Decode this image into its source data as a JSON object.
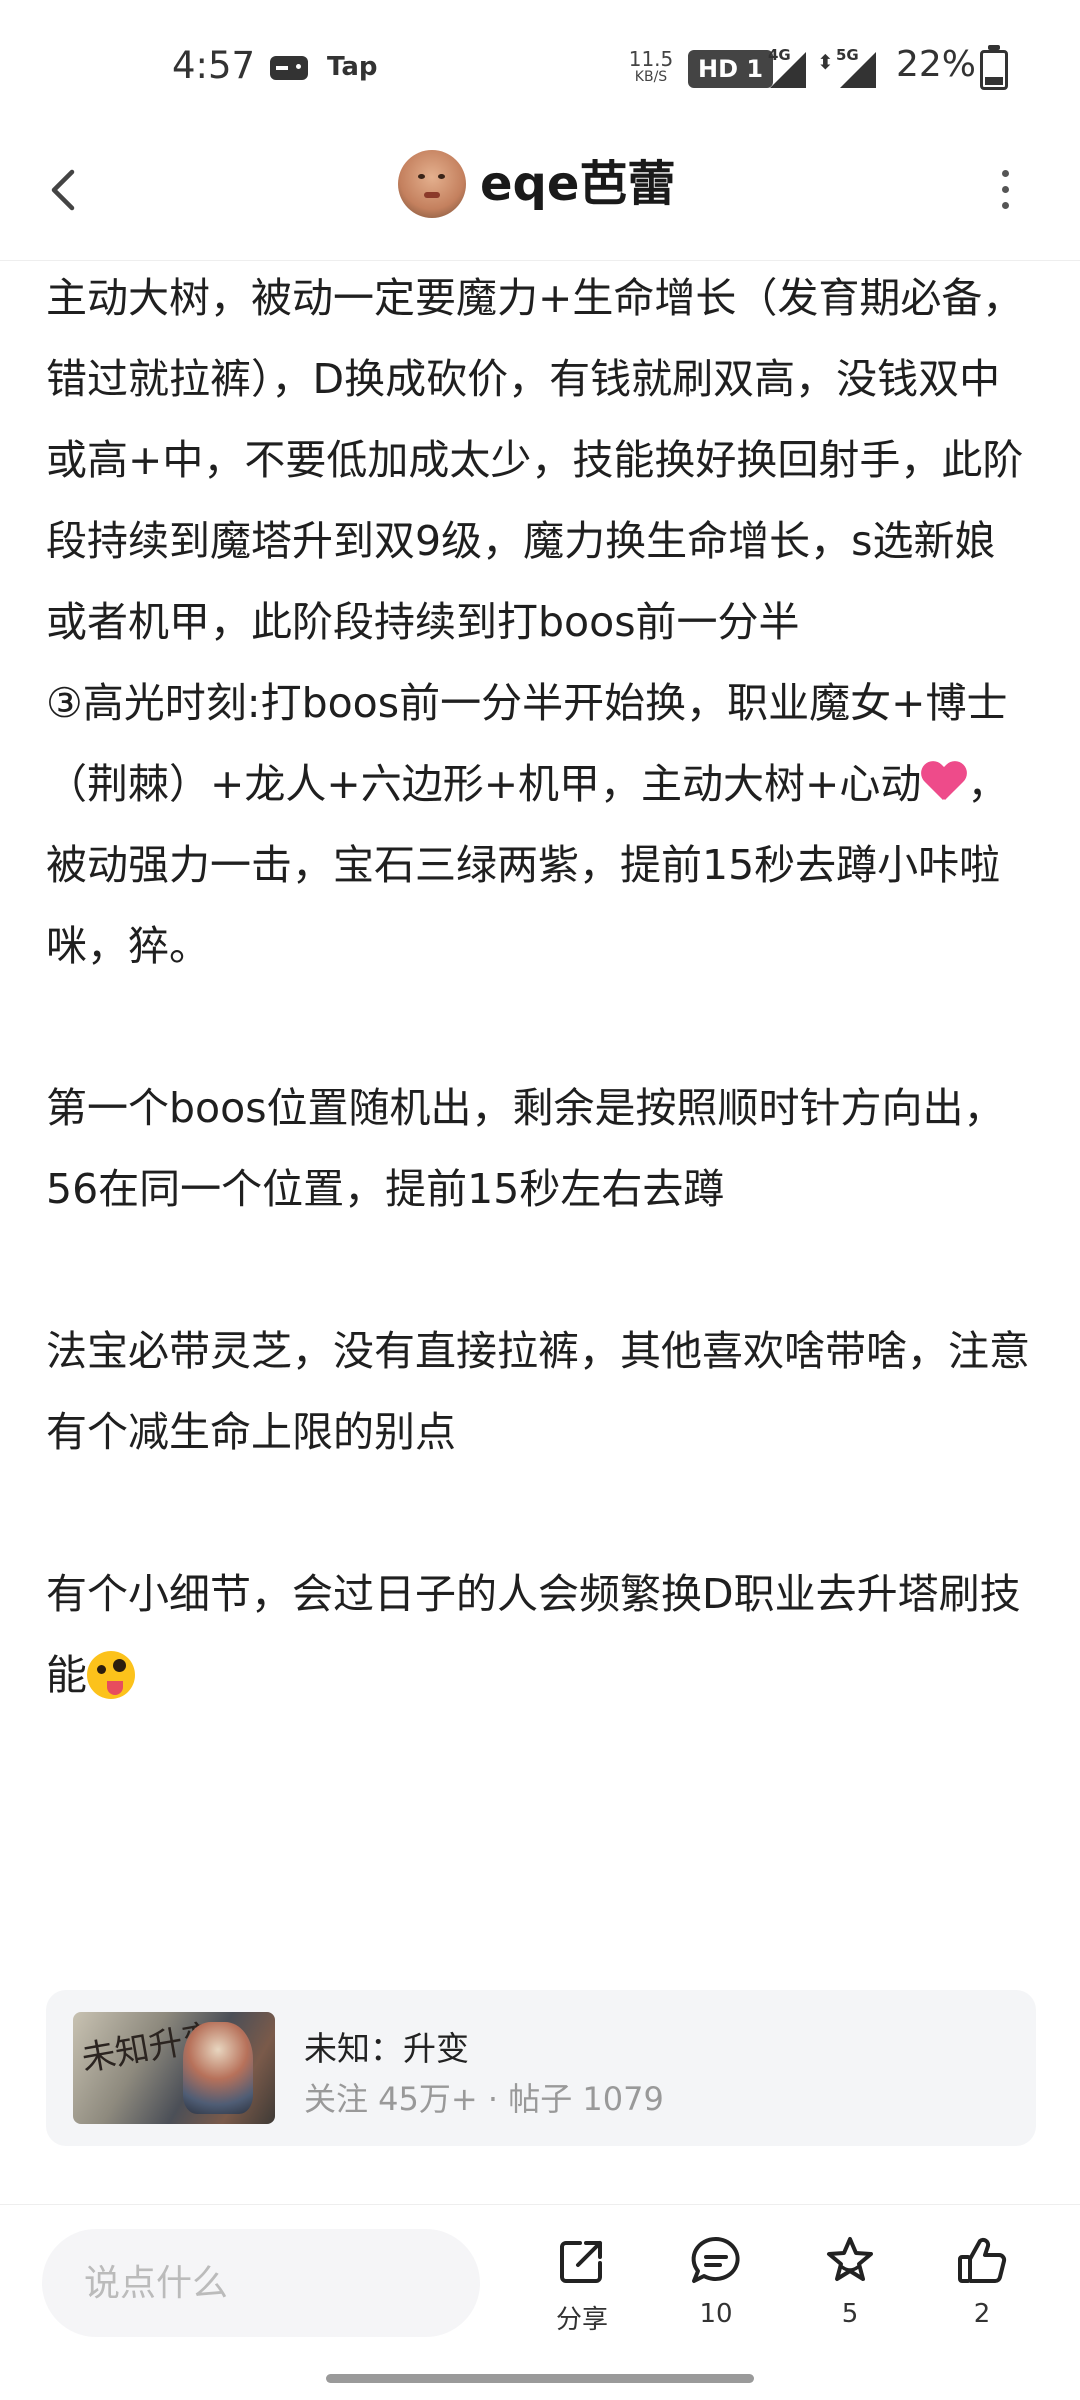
{
  "status_bar": {
    "time": "4:57",
    "tap_label": "Tap",
    "speed_value": "11.5",
    "speed_unit": "KB/S",
    "hd_label": "HD 1",
    "net1": "4G",
    "net2": "5G",
    "battery": "22%",
    "icons": [
      "game-controller-icon",
      "signal-icon",
      "data-arrows-icon",
      "battery-icon"
    ]
  },
  "header": {
    "username": "eqe芭蕾",
    "icons": [
      "back-arrow-icon",
      "avatar",
      "more-vertical-icon"
    ]
  },
  "article": {
    "paragraphs": [
      "主动大树，被动一定要魔力+生命增长（发育期必备，错过就拉裤），D换成砍价，有钱就刷双高，没钱双中或高+中，不要低加成太少，技能换好换回射手，此阶段持续到魔塔升到双9级，魔力换生命增长，s选新娘或者机甲，此阶段持续到打boos前一分半",
      "③高光时刻:打boos前一分半开始换，职业魔女+博士（荆棘）+龙人+六边形+机甲，主动大树+心动",
      "，被动强力一击，宝石三绿两紫，提前15秒去蹲小咔啦咪，猝。",
      "第一个boos位置随机出，剩余是按照顺时针方向出，56在同一个位置，提前15秒左右去蹲",
      "法宝必带灵芝，没有直接拉裤，其他喜欢啥带啥，注意有个减生命上限的别点",
      "有个小细节，会过日子的人会频繁换D职业去升塔刷技能"
    ],
    "emojis": [
      "heart-emoji",
      "zany-face-emoji"
    ]
  },
  "circle_card": {
    "name": "未知：升变",
    "followers": "关注 45万+",
    "separator": "·",
    "posts": "帖子 1079",
    "thumb_text": "未知升变"
  },
  "bottom_bar": {
    "input_placeholder": "说点什么",
    "share_label": "分享",
    "comment_count": "10",
    "favorite_count": "5",
    "like_count": "2"
  },
  "colors": {
    "text": "#1f1f1f",
    "muted": "#999999",
    "card_bg": "#f4f5f7",
    "heart": "#ee4b8a"
  }
}
